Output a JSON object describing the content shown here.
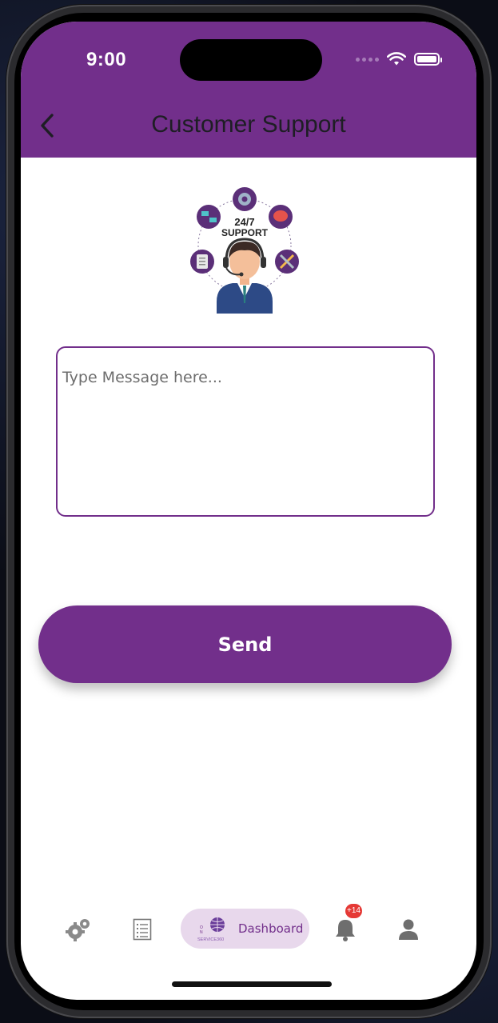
{
  "status_bar": {
    "time": "9:00"
  },
  "header": {
    "title": "Customer Support"
  },
  "illustration": {
    "line1": "24/7",
    "line2": "SUPPORT"
  },
  "message": {
    "placeholder": "Type Message here..."
  },
  "send_button": {
    "label": "Send"
  },
  "bottom_nav": {
    "items": [
      {
        "icon": "settings-gear-icon"
      },
      {
        "icon": "list-document-icon"
      },
      {
        "label": "Dashboard",
        "icon": "globe-logo-icon",
        "logo_text": "SERVICE360"
      },
      {
        "icon": "bell-icon",
        "badge": "+14"
      },
      {
        "icon": "person-icon"
      }
    ]
  },
  "colors": {
    "brand": "#722f8b",
    "active_pill": "#e8d8ec",
    "badge": "#e53935"
  }
}
